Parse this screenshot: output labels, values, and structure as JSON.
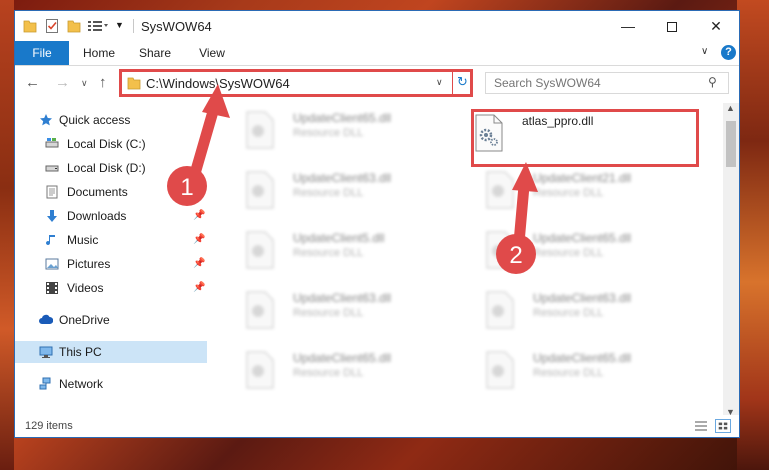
{
  "window": {
    "title": "SysWOW64"
  },
  "ribbon": {
    "tabs": [
      "File",
      "Home",
      "Share",
      "View"
    ]
  },
  "address": {
    "path": "C:\\Windows\\SysWOW64"
  },
  "search": {
    "placeholder": "Search SysWOW64"
  },
  "sidebar": {
    "items": [
      {
        "label": "Quick access",
        "icon": "star-icon",
        "pinned": false
      },
      {
        "label": "Local Disk (C:)",
        "icon": "drive-icon",
        "pinned": false
      },
      {
        "label": "Local Disk (D:)",
        "icon": "drive-icon",
        "pinned": false
      },
      {
        "label": "Documents",
        "icon": "documents-icon",
        "pinned": false
      },
      {
        "label": "Downloads",
        "icon": "download-icon",
        "pinned": true
      },
      {
        "label": "Music",
        "icon": "music-icon",
        "pinned": true
      },
      {
        "label": "Pictures",
        "icon": "pictures-icon",
        "pinned": true
      },
      {
        "label": "Videos",
        "icon": "videos-icon",
        "pinned": true
      },
      {
        "label": "OneDrive",
        "icon": "cloud-icon",
        "pinned": false
      },
      {
        "label": "This PC",
        "icon": "computer-icon",
        "pinned": false,
        "selected": true
      },
      {
        "label": "Network",
        "icon": "network-icon",
        "pinned": false
      }
    ]
  },
  "files": {
    "selected": {
      "name": "atlas_ppro.dll",
      "type": ""
    },
    "left": [
      {
        "name": "UpdateClient65.dll",
        "type": "Resource DLL"
      },
      {
        "name": "UpdateClient63.dll",
        "type": "Resource DLL"
      },
      {
        "name": "UpdateClient5.dll",
        "type": "Resource DLL"
      },
      {
        "name": "UpdateClient63.dll",
        "type": "Resource DLL"
      },
      {
        "name": "UpdateClient65.dll",
        "type": "Resource DLL"
      }
    ],
    "right": [
      {
        "name": "UpdateClient21.dll",
        "type": "Resource DLL"
      },
      {
        "name": "UpdateClient65.dll",
        "type": "Resource DLL"
      },
      {
        "name": "UpdateClient63.dll",
        "type": "Resource DLL"
      },
      {
        "name": "UpdateClient65.dll",
        "type": "Resource DLL"
      }
    ]
  },
  "status": {
    "count": "129 items"
  },
  "annotations": {
    "step1": "1",
    "step2": "2",
    "color": "#e04a4a"
  }
}
